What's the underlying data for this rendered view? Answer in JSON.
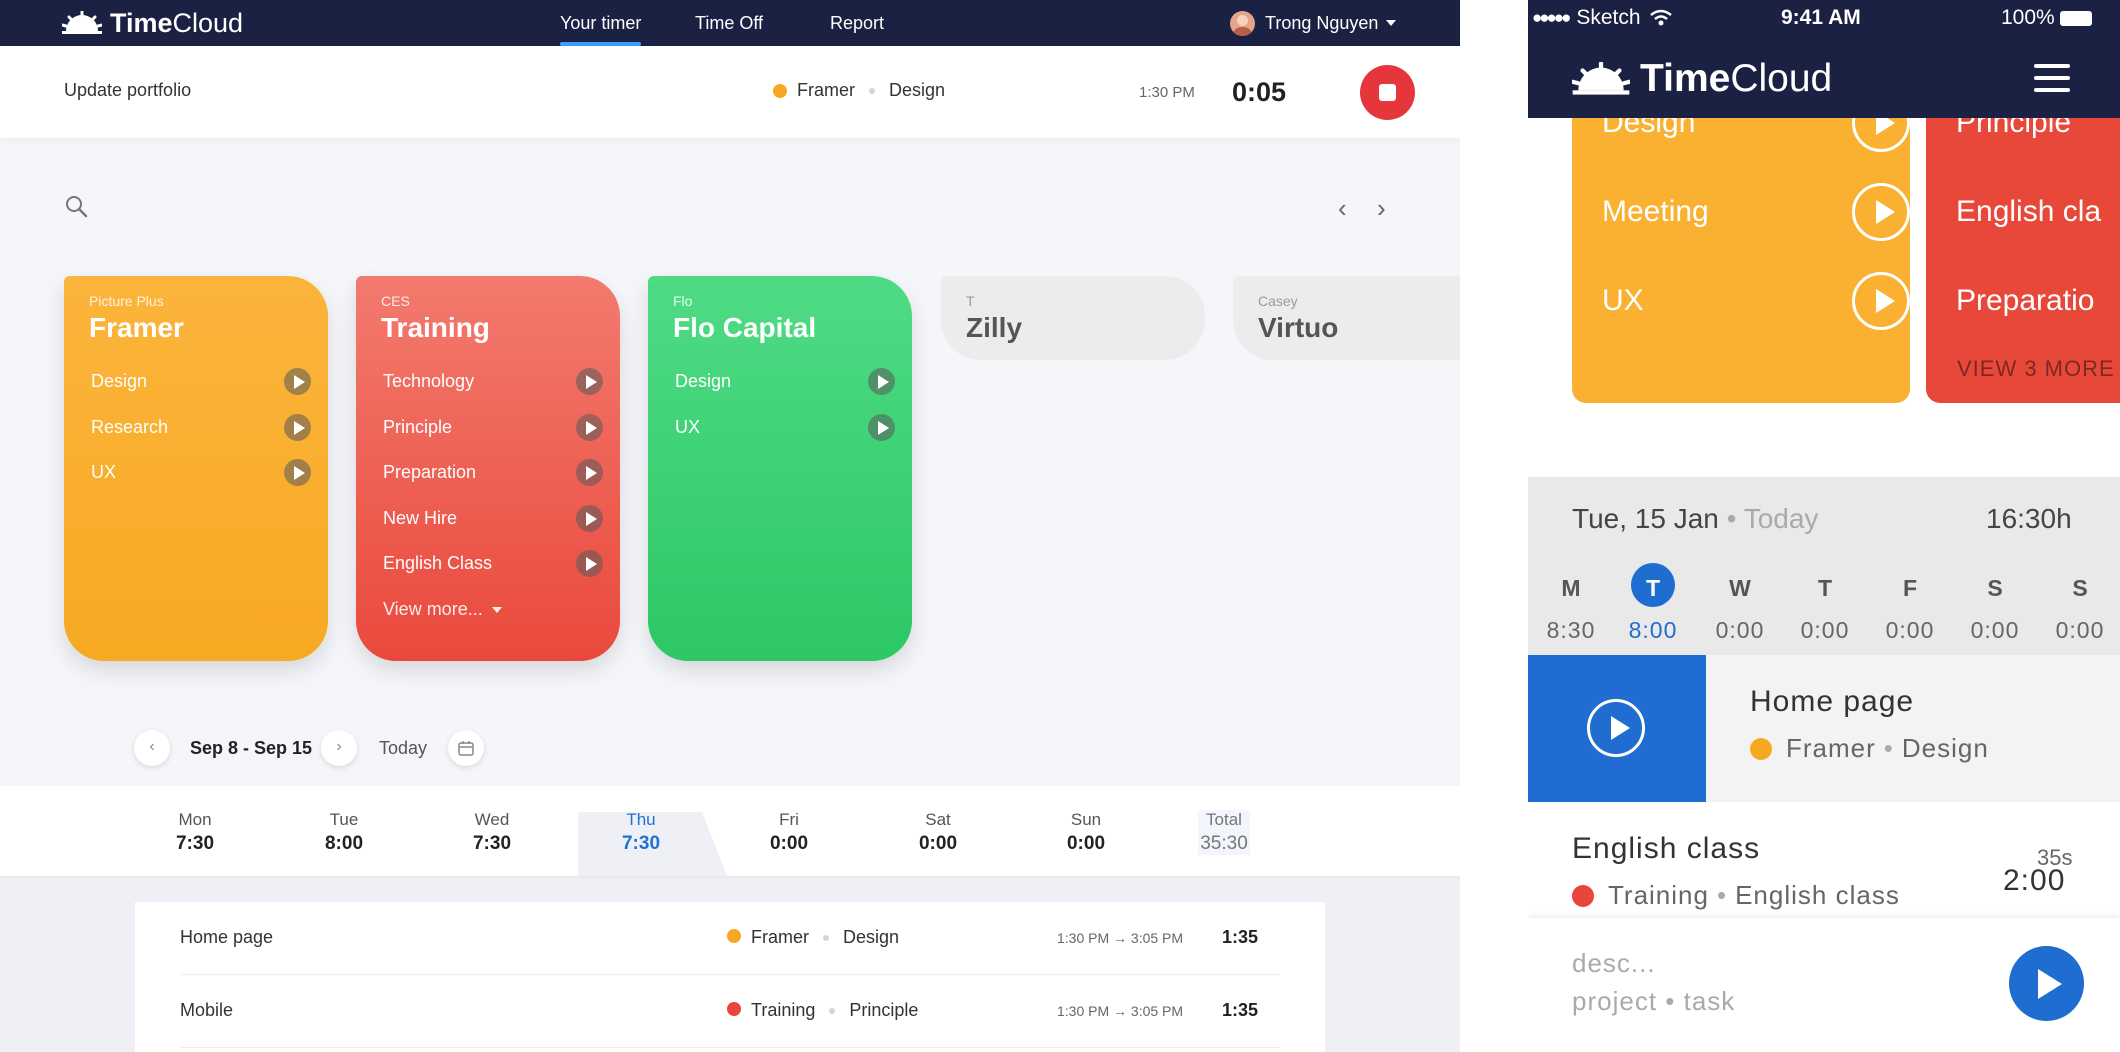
{
  "desktop": {
    "brand": {
      "bold": "Time",
      "light": "Cloud"
    },
    "nav": [
      {
        "label": "Your timer",
        "active": true
      },
      {
        "label": "Time Off"
      },
      {
        "label": "Report"
      }
    ],
    "user": {
      "name": "Trong Nguyen"
    },
    "current": {
      "description": "Update portfolio",
      "project": "Framer",
      "task": "Design",
      "project_color": "#f7a823",
      "start_time": "1:30 PM",
      "elapsed": "0:05"
    },
    "projects": [
      {
        "client": "Picture Plus",
        "name": "Framer",
        "tasks": [
          "Design",
          "Research",
          "UX"
        ]
      },
      {
        "client": "CES",
        "name": "Training",
        "tasks": [
          "Technology",
          "Principle",
          "Preparation",
          "New Hire",
          "English Class"
        ],
        "more_label": "View more..."
      },
      {
        "client": "Flo",
        "name": "Flo Capital",
        "tasks": [
          "Design",
          "UX"
        ]
      },
      {
        "client": "T",
        "name": "Zilly"
      },
      {
        "client": "Casey",
        "name": "Virtuo"
      }
    ],
    "week": {
      "range": "Sep 8 - Sep 15",
      "today_label": "Today",
      "days": [
        {
          "name": "Mon",
          "value": "7:30"
        },
        {
          "name": "Tue",
          "value": "8:00"
        },
        {
          "name": "Wed",
          "value": "7:30"
        },
        {
          "name": "Thu",
          "value": "7:30",
          "selected": true
        },
        {
          "name": "Fri",
          "value": "0:00"
        },
        {
          "name": "Sat",
          "value": "0:00"
        },
        {
          "name": "Sun",
          "value": "0:00"
        },
        {
          "name": "Total",
          "value": "35:30"
        }
      ]
    },
    "entries": [
      {
        "title": "Home page",
        "project": "Framer",
        "task": "Design",
        "color": "#f7a823",
        "start": "1:30 PM",
        "end": "3:05 PM",
        "duration": "1:35"
      },
      {
        "title": "Mobile",
        "project": "Training",
        "task": "Principle",
        "color": "#e8463b",
        "start": "1:30 PM",
        "end": "3:05 PM",
        "duration": "1:35"
      }
    ]
  },
  "mobile": {
    "status": {
      "carrier": "Sketch",
      "time": "9:41 AM",
      "battery": "100%"
    },
    "brand": {
      "bold": "Time",
      "light": "Cloud"
    },
    "card1_tasks": [
      "Design",
      "Meeting",
      "UX"
    ],
    "card2_tasks": [
      "Principle",
      "English cla",
      "Preparatio"
    ],
    "card2_more": "VIEW 3 MORE",
    "date": {
      "label": "Tue, 15 Jan",
      "today": "Today",
      "total": "16:30h"
    },
    "days": [
      {
        "letter": "M",
        "value": "8:30"
      },
      {
        "letter": "T",
        "value": "8:00",
        "selected": true
      },
      {
        "letter": "W",
        "value": "0:00"
      },
      {
        "letter": "T",
        "value": "0:00"
      },
      {
        "letter": "F",
        "value": "0:00"
      },
      {
        "letter": "S",
        "value": "0:00"
      },
      {
        "letter": "S",
        "value": "0:00"
      }
    ],
    "active_entry": {
      "title": "Home page",
      "project": "Framer",
      "task": "Design",
      "color": "#f7a823"
    },
    "entry": {
      "title": "English class",
      "project": "Training",
      "task": "English class",
      "color": "#e8463b",
      "seconds": "35s",
      "duration": "2:00"
    },
    "new_entry": {
      "description_placeholder": "desc...",
      "project_placeholder": "project",
      "task_placeholder": "task"
    }
  }
}
